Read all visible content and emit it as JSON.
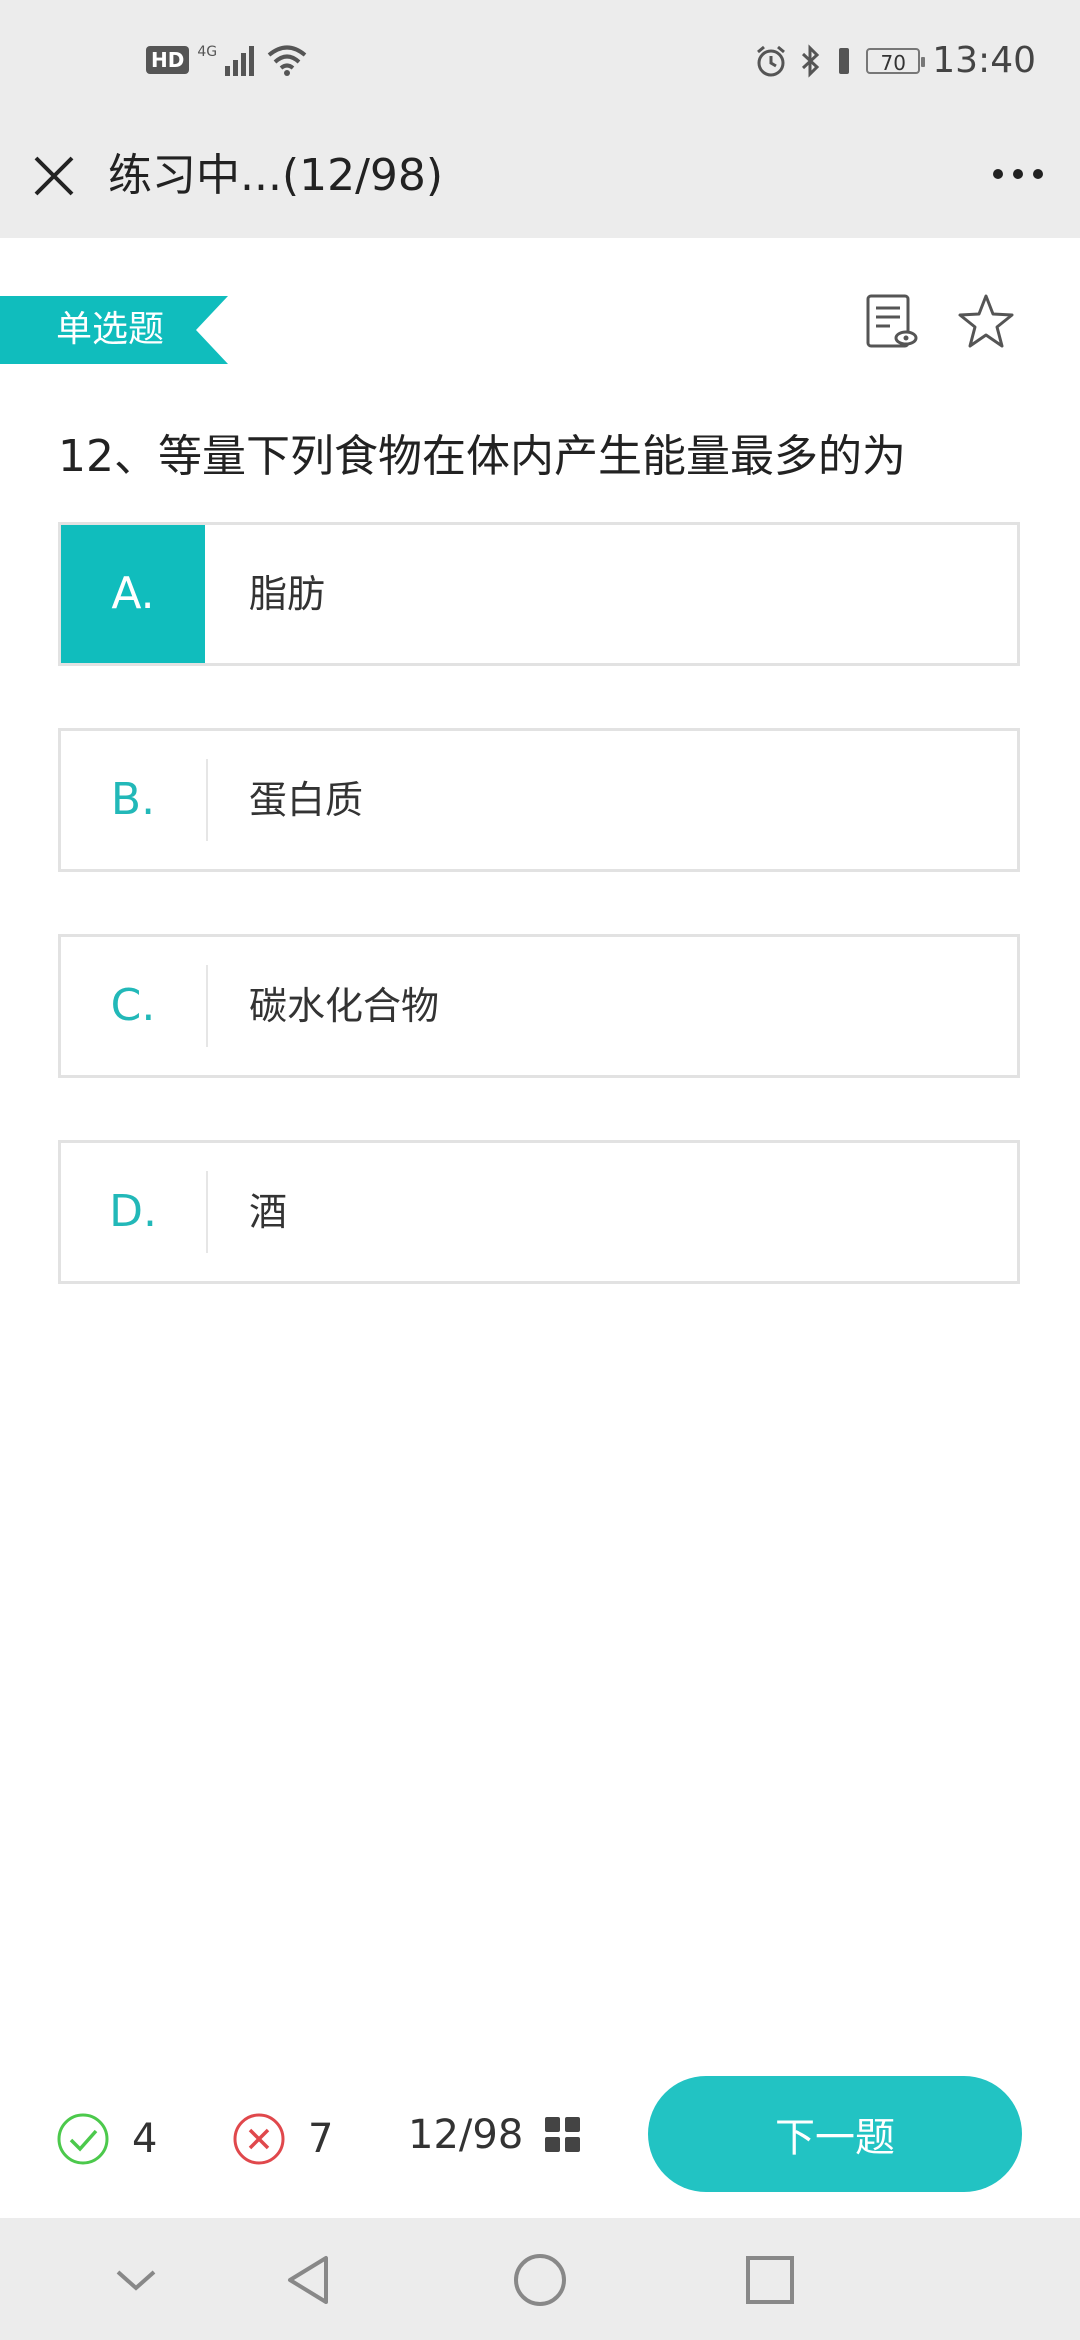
{
  "status_bar": {
    "hd": "HD",
    "network": "4G",
    "battery": "70",
    "time": "13:40"
  },
  "header": {
    "title": "练习中...(12/98)"
  },
  "question": {
    "type": "单选题",
    "text": "12、等量下列食物在体内产生能量最多的为",
    "options": [
      {
        "letter": "A.",
        "text": "脂肪"
      },
      {
        "letter": "B.",
        "text": "蛋白质"
      },
      {
        "letter": "C.",
        "text": "碳水化合物"
      },
      {
        "letter": "D.",
        "text": "酒"
      }
    ]
  },
  "footer": {
    "correct_count": "4",
    "wrong_count": "7",
    "progress": "12/98",
    "next_label": "下一题"
  },
  "colors": {
    "accent": "#22c3c3",
    "correct": "#4cc94c",
    "wrong": "#e0484c"
  }
}
